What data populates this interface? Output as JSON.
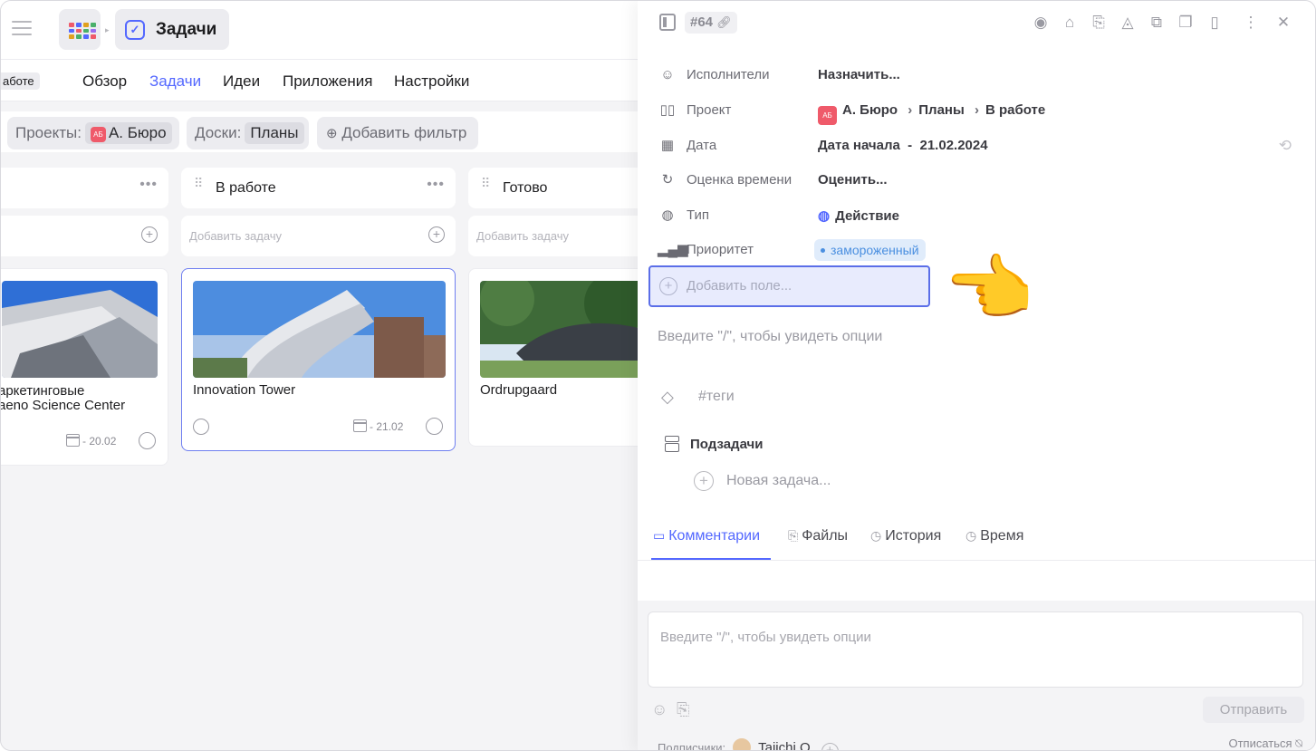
{
  "topbar": {
    "title": "Задачи"
  },
  "tabs": {
    "badge": "аботе",
    "items": [
      "Обзор",
      "Задачи",
      "Идеи",
      "Приложения",
      "Настройки"
    ],
    "active_index": 1
  },
  "filters": {
    "projects_label": "Проекты:",
    "projects_avatar": "АБ",
    "projects_value": "А. Бюро",
    "boards_label": "Доски:",
    "boards_value": "Планы",
    "add_filter": "Добавить фильтр"
  },
  "board": {
    "columns": [
      {
        "name": "",
        "add_placeholder": ""
      },
      {
        "name": "В работе",
        "add_placeholder": "Добавить задачу"
      },
      {
        "name": "Готово",
        "add_placeholder": "Добавить задачу"
      }
    ],
    "cards": [
      {
        "title_line1": "аркетинговые",
        "title_line2": "aeno Science Center",
        "date": "20.02"
      },
      {
        "title": "Innovation Tower",
        "date": "21.02"
      },
      {
        "title": "Ordrupgaard"
      }
    ]
  },
  "panel": {
    "task_id": "#64",
    "props": {
      "assignees_label": "Исполнители",
      "assignees_value": "Назначить...",
      "project_label": "Проект",
      "project_avatar": "АБ",
      "project_path": [
        "А. Бюро",
        "Планы",
        "В работе"
      ],
      "date_label": "Дата",
      "date_value": "Дата начала  -  21.02.2024",
      "estimate_label": "Оценка времени",
      "estimate_value": "Оценить...",
      "type_label": "Тип",
      "type_value": "Действие",
      "priority_label": "Приоритет",
      "priority_value": "замороженный"
    },
    "add_field": "Добавить поле...",
    "hint": "Введите \"/\", чтобы увидеть опции",
    "tags": "#теги",
    "subtasks": "Подзадачи",
    "new_task": "Новая задача...",
    "tabs": [
      "Комментарии",
      "Файлы",
      "История",
      "Время"
    ],
    "comment_placeholder": "Введите \"/\", чтобы увидеть опции",
    "send": "Отправить",
    "subscribers_label": "Подписчики:",
    "subscriber": "Taiichi O.",
    "unsubscribe": "Отписаться"
  },
  "colors": {
    "accent": "#5468ff",
    "priority": "#4a8fe0",
    "avatar": "#ef5a6a"
  }
}
